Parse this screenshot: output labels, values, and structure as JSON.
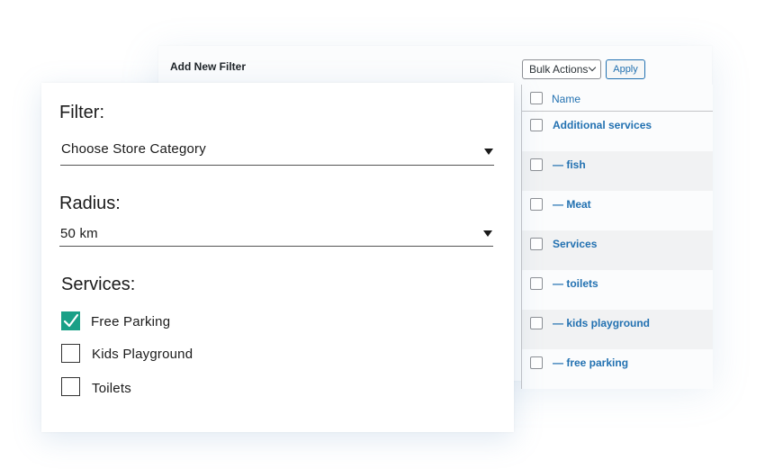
{
  "admin": {
    "add_new_title": "Add New Filter",
    "bulk_actions_label": "Bulk Actions",
    "apply_label": "Apply",
    "table": {
      "header": "Name",
      "rows": [
        "Additional services",
        "— fish",
        "— Meat",
        "Services",
        "— toilets",
        "— kids playground",
        "— free parking"
      ]
    }
  },
  "filter_form": {
    "filter_label": "Filter:",
    "filter_value": "Choose Store Category",
    "radius_label": "Radius:",
    "radius_value": "50 km",
    "services_label": "Services:",
    "services": [
      {
        "label": "Free Parking",
        "checked": true
      },
      {
        "label": "Kids Playground",
        "checked": false
      },
      {
        "label": "Toilets",
        "checked": false
      }
    ]
  },
  "colors": {
    "accent": "#1aa087",
    "link": "#2271b1"
  }
}
